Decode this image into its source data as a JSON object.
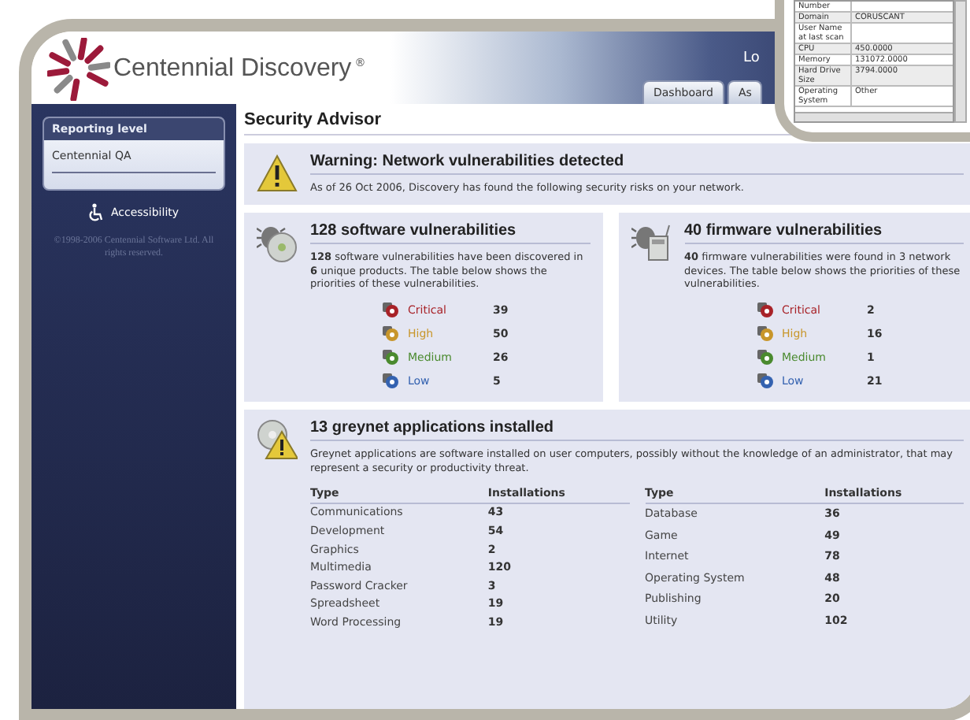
{
  "header": {
    "brand": "Centennial Discovery",
    "brand_mark": "®",
    "user_text": "Lo",
    "tabs": [
      {
        "label": "Dashboard",
        "selected": false
      },
      {
        "label": "As",
        "selected": false
      }
    ]
  },
  "sidebar": {
    "panel_title": "Reporting level",
    "level_value": "Centennial QA",
    "accessibility": "Accessibility",
    "copyright": "©1998-2006 Centennial Software Ltd. All rights reserved."
  },
  "page_title": "Security Advisor",
  "warning": {
    "title": "Warning: Network vulnerabilities detected",
    "text": "As of 26 Oct 2006, Discovery has found the following security risks on your network."
  },
  "vulnerability_panels": [
    {
      "kind": "software",
      "title": "128 software vulnerabilities",
      "text": "**128** software vulnerabilities have been discovered in **6** unique products. The table below shows the priorities of these vulnerabilities.",
      "priorities": [
        {
          "label": "Critical",
          "count": "39",
          "color": "#a82228"
        },
        {
          "label": "High",
          "count": "50",
          "color": "#c8962a"
        },
        {
          "label": "Medium",
          "count": "26",
          "color": "#4a8a2e"
        },
        {
          "label": "Low",
          "count": "5",
          "color": "#3462b0"
        }
      ]
    },
    {
      "kind": "firmware",
      "title": "40 firmware vulnerabilities",
      "text": "**40** firmware vulnerabilities were found in 3 network devices. The table below shows the priorities of these vulnerabilities.",
      "priorities": [
        {
          "label": "Critical",
          "count": "2",
          "color": "#a82228"
        },
        {
          "label": "High",
          "count": "16",
          "color": "#c8962a"
        },
        {
          "label": "Medium",
          "count": "1",
          "color": "#4a8a2e"
        },
        {
          "label": "Low",
          "count": "21",
          "color": "#3462b0"
        }
      ]
    }
  ],
  "greynet": {
    "title": "13 greynet applications installed",
    "text": "Greynet applications are software installed on user computers, possibly without the knowledge of an administrator, that may represent a security or productivity threat.",
    "tables": [
      {
        "columns": [
          "Type",
          "Installations"
        ],
        "rows": [
          [
            "Communications",
            "43"
          ],
          [
            "Development",
            "54"
          ],
          [
            "Graphics",
            "2"
          ],
          [
            "Multimedia",
            "120"
          ],
          [
            "Password Cracker",
            "3"
          ],
          [
            "Spreadsheet",
            "19"
          ],
          [
            "Word Processing",
            "19"
          ]
        ]
      },
      {
        "columns": [
          "Type",
          "Installations"
        ],
        "rows": [
          [
            "Database",
            "36"
          ],
          [
            "Game",
            "49"
          ],
          [
            "Internet",
            "78"
          ],
          [
            "Operating System",
            "48"
          ],
          [
            "Publishing",
            "20"
          ],
          [
            "Utility",
            "102"
          ]
        ]
      }
    ]
  },
  "popup": {
    "rows": [
      {
        "label": "Number",
        "value": ""
      },
      {
        "label": "Domain",
        "value": "CORUSCANT"
      },
      {
        "label": "User Name at last scan",
        "value": ""
      },
      {
        "label": "CPU",
        "value": "450.0000"
      },
      {
        "label": "Memory",
        "value": "131072.0000"
      },
      {
        "label": "Hard Drive Size",
        "value": "3794.0000"
      },
      {
        "label": "Operating System",
        "value": "Other"
      }
    ]
  }
}
